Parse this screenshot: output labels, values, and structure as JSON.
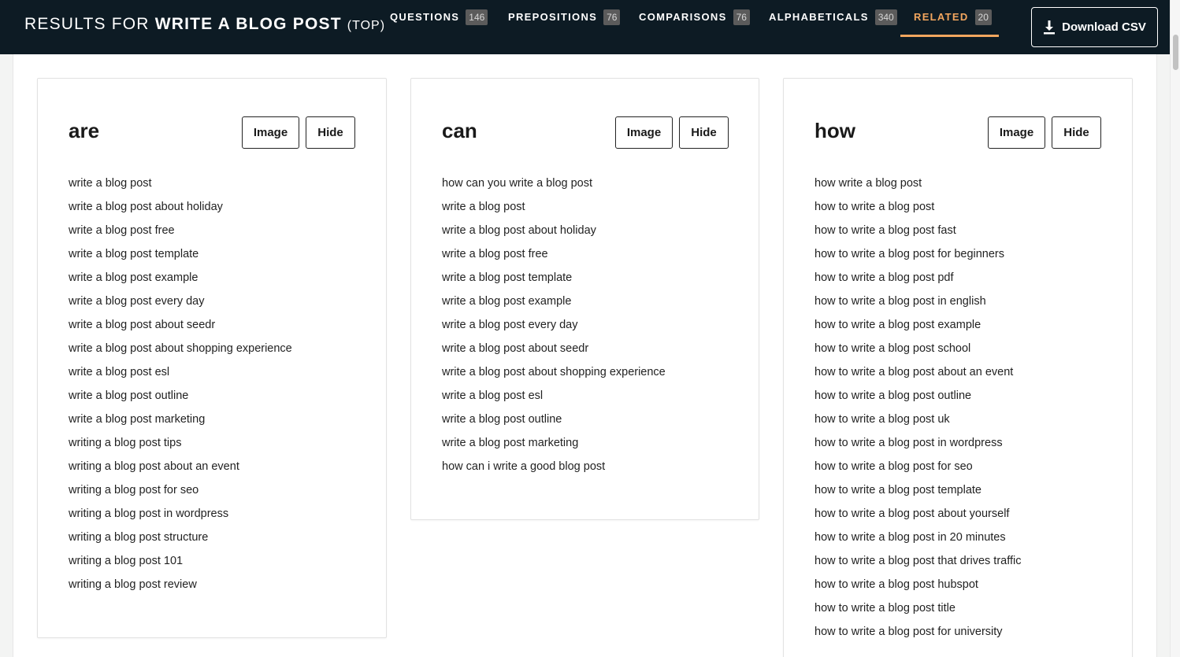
{
  "header": {
    "results_prefix": "RESULTS FOR",
    "query": "WRITE A BLOG POST",
    "mode": "(TOP)",
    "tabs": [
      {
        "label": "QUESTIONS",
        "count": "146"
      },
      {
        "label": "PREPOSITIONS",
        "count": "76"
      },
      {
        "label": "COMPARISONS",
        "count": "76"
      },
      {
        "label": "ALPHABETICALS",
        "count": "340"
      },
      {
        "label": "RELATED",
        "count": "20"
      }
    ],
    "active_tab": "RELATED",
    "download_label": "Download CSV"
  },
  "colors": {
    "header_bg": "#0d1b24",
    "accent": "#f2a65e",
    "count_badge_bg": "#5b5b5b"
  },
  "cards": [
    {
      "title": "are",
      "image_label": "Image",
      "hide_label": "Hide",
      "items": [
        "write a blog post",
        "write a blog post about holiday",
        "write a blog post free",
        "write a blog post template",
        "write a blog post example",
        "write a blog post every day",
        "write a blog post about seedr",
        "write a blog post about shopping experience",
        "write a blog post esl",
        "write a blog post outline",
        "write a blog post marketing",
        "writing a blog post tips",
        "writing a blog post about an event",
        "writing a blog post for seo",
        "writing a blog post in wordpress",
        "writing a blog post structure",
        "writing a blog post 101",
        "writing a blog post review"
      ]
    },
    {
      "title": "can",
      "image_label": "Image",
      "hide_label": "Hide",
      "items": [
        "how can you write a blog post",
        "write a blog post",
        "write a blog post about holiday",
        "write a blog post free",
        "write a blog post template",
        "write a blog post example",
        "write a blog post every day",
        "write a blog post about seedr",
        "write a blog post about shopping experience",
        "write a blog post esl",
        "write a blog post outline",
        "write a blog post marketing",
        "how can i write a good blog post"
      ]
    },
    {
      "title": "how",
      "image_label": "Image",
      "hide_label": "Hide",
      "items": [
        "how write a blog post",
        "how to write a blog post",
        "how to write a blog post fast",
        "how to write a blog post for beginners",
        "how to write a blog post pdf",
        "how to write a blog post in english",
        "how to write a blog post example",
        "how to write a blog post school",
        "how to write a blog post about an event",
        "how to write a blog post outline",
        "how to write a blog post uk",
        "how to write a blog post in wordpress",
        "how to write a blog post for seo",
        "how to write a blog post template",
        "how to write a blog post about yourself",
        "how to write a blog post in 20 minutes",
        "how to write a blog post that drives traffic",
        "how to write a blog post hubspot",
        "how to write a blog post title",
        "how to write a blog post for university"
      ]
    }
  ]
}
